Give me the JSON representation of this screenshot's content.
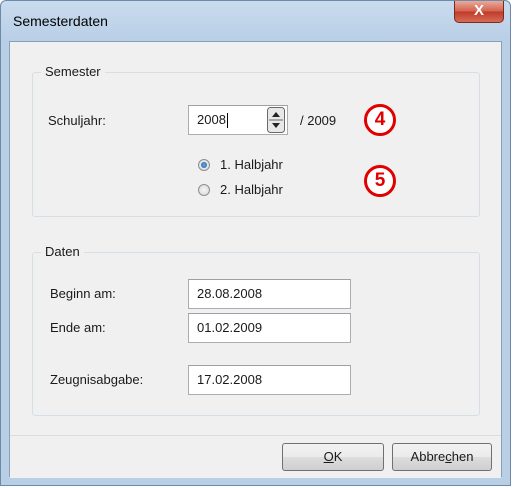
{
  "window": {
    "title": "Semesterdaten",
    "close_label": "X"
  },
  "semester": {
    "legend": "Semester",
    "schuljahr_label": "Schuljahr:",
    "schuljahr_value": "2008",
    "schuljahr_end": "/ 2009",
    "radios": [
      {
        "label": "1. Halbjahr",
        "checked": true
      },
      {
        "label": "2. Halbjahr",
        "checked": false
      }
    ],
    "callout_4": "4",
    "callout_5": "5"
  },
  "daten": {
    "legend": "Daten",
    "beginn_label": "Beginn am:",
    "beginn_value": "28.08.2008",
    "ende_label": "Ende am:",
    "ende_value": "01.02.2009",
    "zeugnis_label": "Zeugnisabgabe:",
    "zeugnis_value": "17.02.2008"
  },
  "buttons": {
    "ok_mnemonic": "O",
    "ok_rest": "K",
    "cancel_pre": "Abbre",
    "cancel_mnemonic": "c",
    "cancel_post": "hen"
  },
  "colors": {
    "accent": "#e10000",
    "titlebar": "#b9cfe6",
    "close": "#c0392b"
  }
}
